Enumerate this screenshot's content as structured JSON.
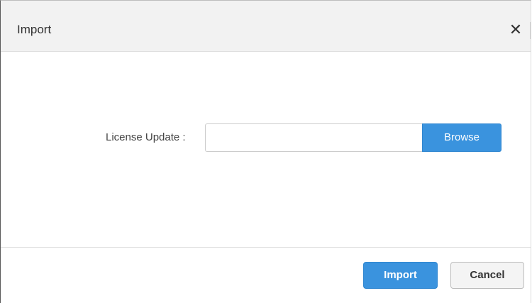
{
  "dialog": {
    "title": "Import",
    "close_icon": "close-icon",
    "close_glyph": "✕"
  },
  "form": {
    "license_label": "License Update :",
    "file_value": "",
    "browse_label": "Browse"
  },
  "footer": {
    "import_label": "Import",
    "cancel_label": "Cancel"
  },
  "colors": {
    "primary": "#3a93de",
    "header_bg": "#f2f2f2",
    "secondary_bg": "#f4f4f4"
  }
}
